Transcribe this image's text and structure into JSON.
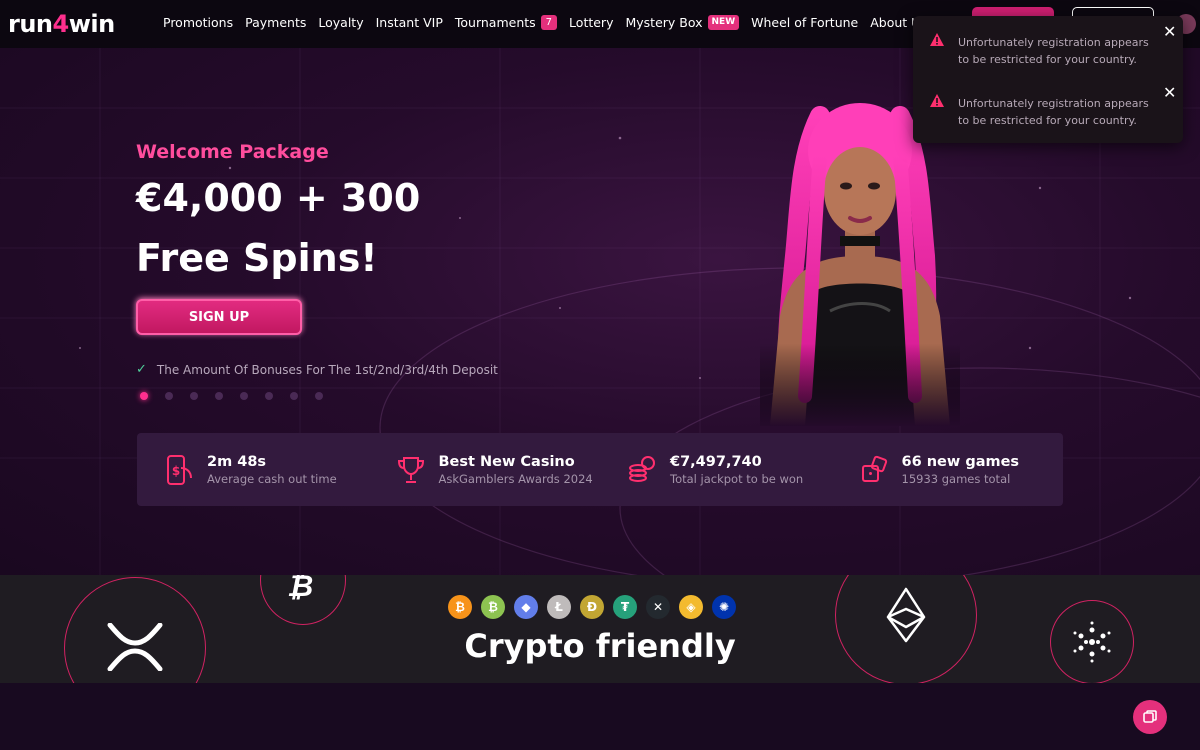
{
  "header": {
    "logo_prefix": "run",
    "logo_four": "4",
    "logo_suffix": "win",
    "nav": [
      {
        "label": "Promotions"
      },
      {
        "label": "Payments"
      },
      {
        "label": "Loyalty"
      },
      {
        "label": "Instant VIP"
      },
      {
        "label": "Tournaments",
        "badge": "7"
      },
      {
        "label": "Lottery"
      },
      {
        "label": "Mystery Box",
        "badge": "NEW"
      },
      {
        "label": "Wheel of Fortune"
      },
      {
        "label": "About Us"
      }
    ]
  },
  "hero": {
    "subtitle": "Welcome Package",
    "title_line1": "€4,000 + 300",
    "title_line2": "Free Spins!",
    "cta": "SIGN UP",
    "note": "The Amount Of Bonuses For The 1st/2nd/3rd/4th Deposit",
    "slides_total": 8,
    "active_slide": 1
  },
  "stats": [
    {
      "title": "2m 48s",
      "sub": "Average cash out time",
      "icon": "phone-cash-icon"
    },
    {
      "title": "Best New Casino",
      "sub": "AskGamblers Awards 2024",
      "icon": "trophy-icon"
    },
    {
      "title": "€7,497,740",
      "sub": "Total jackpot to be won",
      "icon": "coins-icon"
    },
    {
      "title": "66 new games",
      "sub": "15933 games total",
      "icon": "dice-icon"
    }
  ],
  "crypto": {
    "title": "Crypto friendly",
    "coins": [
      {
        "name": "bitcoin",
        "symbol": "₿",
        "color": "#f7931a"
      },
      {
        "name": "bitcoin-cash",
        "symbol": "₿",
        "color": "#8dc351"
      },
      {
        "name": "ethereum",
        "symbol": "◆",
        "color": "#627eea"
      },
      {
        "name": "litecoin",
        "symbol": "Ł",
        "color": "#bfbbbb"
      },
      {
        "name": "dogecoin",
        "symbol": "Ð",
        "color": "#c2a633"
      },
      {
        "name": "tether",
        "symbol": "₮",
        "color": "#26a17b"
      },
      {
        "name": "ripple",
        "symbol": "✕",
        "color": "#23292f"
      },
      {
        "name": "binance",
        "symbol": "◈",
        "color": "#f3ba2f"
      },
      {
        "name": "cardano",
        "symbol": "✺",
        "color": "#0033ad"
      }
    ]
  },
  "toasts": [
    {
      "message": "Unfortunately registration appears to be restricted for your country."
    },
    {
      "message": "Unfortunately registration appears to be restricted for your country."
    }
  ],
  "colors": {
    "accent": "#ff2f8e",
    "button": "#d11f73",
    "hero_bg": "#250b2b",
    "crypto_bg": "#1f1c22"
  }
}
